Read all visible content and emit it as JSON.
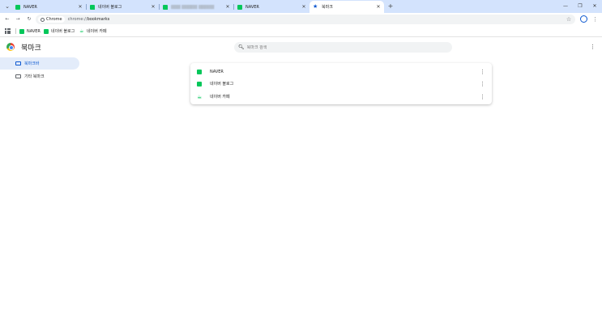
{
  "tabs": [
    {
      "title": "NAVER",
      "icon": "naver-icon"
    },
    {
      "title": "네이버 블로그",
      "icon": "naver-blog-icon"
    },
    {
      "title": "",
      "icon": "naver-blog-icon"
    },
    {
      "title": "NAVER",
      "icon": "naver-icon"
    },
    {
      "title": "북마크",
      "icon": "star-icon",
      "active": true
    }
  ],
  "omnibox": {
    "chip_label": "Chrome",
    "url_scheme": "chrome://",
    "url_path": "bookmarks"
  },
  "bookmarks_bar": [
    {
      "label": "NAVER",
      "icon": "naver-icon"
    },
    {
      "label": "네이버 블로그",
      "icon": "naver-blog-icon"
    },
    {
      "label": "네이버 카페",
      "icon": "naver-cafe-icon"
    }
  ],
  "page": {
    "title": "북마크",
    "search_placeholder": "북마크 검색"
  },
  "sidebar": {
    "items": [
      {
        "label": "북마크바",
        "active": true
      },
      {
        "label": "기타 북마크",
        "active": false
      }
    ]
  },
  "bookmark_list": [
    {
      "name": "NAVER",
      "icon": "naver-icon"
    },
    {
      "name": "네이버 블로그",
      "icon": "naver-blog-icon"
    },
    {
      "name": "네이버 카페",
      "icon": "naver-cafe-icon"
    }
  ],
  "colors": {
    "tabstrip": "#d3e3fd",
    "accent": "#0b57d0",
    "naver_green": "#03c75a",
    "sidebar_active": "#e3ecfa"
  }
}
